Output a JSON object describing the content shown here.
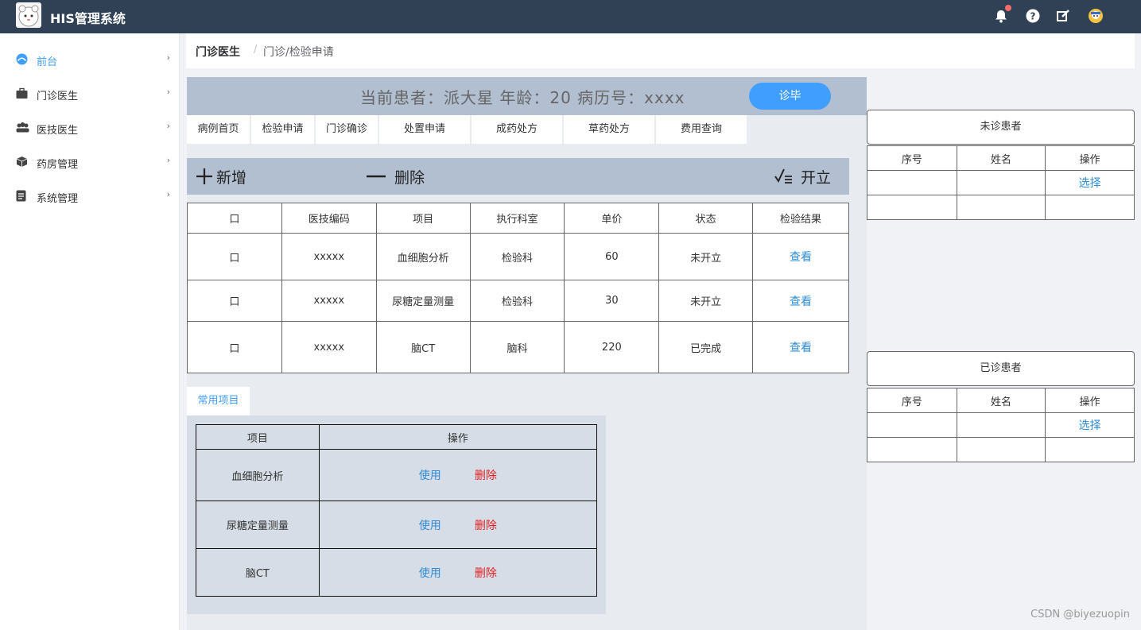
{
  "app": {
    "title": "HIS管理系统"
  },
  "sidebar": {
    "items": [
      {
        "label": "前台",
        "icon": "dashboard-icon",
        "active": true
      },
      {
        "label": "门诊医生",
        "icon": "briefcase-icon"
      },
      {
        "label": "医技医生",
        "icon": "team-icon"
      },
      {
        "label": "药房管理",
        "icon": "box-icon"
      },
      {
        "label": "系统管理",
        "icon": "document-icon"
      }
    ]
  },
  "breadcrumb": {
    "section": "门诊医生",
    "separator": "/",
    "current": "门诊/检验申请"
  },
  "patient": {
    "info": "当前患者：派大星  年龄：20  病历号：xxxx",
    "finish_label": "诊毕"
  },
  "tabs": [
    "病例首页",
    "检验申请",
    "门诊确诊",
    "处置申请",
    "成药处方",
    "草药处方",
    "费用查询"
  ],
  "toolbar": {
    "add_label": "新增",
    "delete_label": "删除",
    "issue_label": "开立"
  },
  "exam_table": {
    "headers": [
      "口",
      "医技编码",
      "项目",
      "执行科室",
      "单价",
      "状态",
      "检验结果"
    ],
    "rows": [
      {
        "check": "口",
        "code": "xxxxx",
        "item": "血细胞分析",
        "dept": "检验科",
        "price": "60",
        "status": "未开立",
        "action": "查看"
      },
      {
        "check": "口",
        "code": "xxxxx",
        "item": "尿糖定量测量",
        "dept": "检验科",
        "price": "30",
        "status": "未开立",
        "action": "查看"
      },
      {
        "check": "口",
        "code": "xxxxx",
        "item": "脑CT",
        "dept": "脑科",
        "price": "220",
        "status": "已完成",
        "action": "查看"
      }
    ]
  },
  "common": {
    "tab_label": "常用项目",
    "headers": [
      "项目",
      "操作"
    ],
    "rows": [
      {
        "item": "血细胞分析",
        "use": "使用",
        "delete": "删除"
      },
      {
        "item": "尿糖定量测量",
        "use": "使用",
        "delete": "删除"
      },
      {
        "item": "脑CT",
        "use": "使用",
        "delete": "删除"
      }
    ]
  },
  "pending": {
    "title": "未诊患者",
    "headers": [
      "序号",
      "姓名",
      "操作"
    ],
    "rows": [
      {
        "no": "",
        "name": "",
        "action": "选择"
      },
      {
        "no": "",
        "name": "",
        "action": ""
      }
    ]
  },
  "done": {
    "title": "已诊患者",
    "headers": [
      "序号",
      "姓名",
      "操作"
    ],
    "rows": [
      {
        "no": "",
        "name": "",
        "action": "选择"
      },
      {
        "no": "",
        "name": "",
        "action": ""
      }
    ]
  },
  "watermark": "CSDN @biyezuopin",
  "colors": {
    "topbar": "#304156",
    "accent": "#409eff",
    "header_band": "#b1bfd1",
    "danger": "#e02020"
  }
}
